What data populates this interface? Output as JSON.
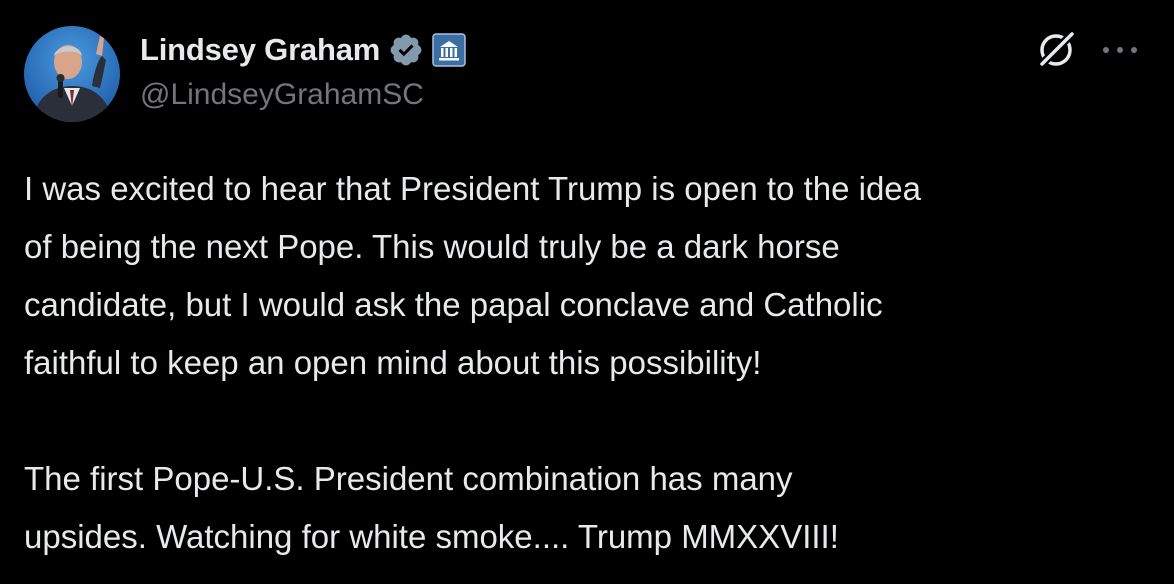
{
  "author": {
    "display_name": "Lindsey Graham",
    "handle": "@LindseyGrahamSC",
    "avatar_icon": "profile-photo",
    "verified_icon": "verified-badge-icon",
    "affiliation_icon": "government-building-icon"
  },
  "actions": {
    "grok_icon": "grok-icon",
    "more_icon": "more-options-icon"
  },
  "tweet": {
    "paragraphs": [
      {
        "lines": [
          "I was excited to hear that President Trump is open to the idea",
          "of being the next Pope. This would truly be a dark horse",
          "candidate, but I would ask the papal conclave and Catholic",
          "faithful to keep an open mind about this possibility!"
        ]
      },
      {
        "lines": [
          "The first Pope-U.S. President combination has many",
          "upsides. Watching for white smoke.... Trump MMXXVIII!"
        ]
      }
    ]
  },
  "colors": {
    "background": "#000000",
    "text_primary": "#e7e9ea",
    "text_secondary": "#71767b",
    "badge_gray": "#829aab",
    "gov_badge": "#3b6ea5"
  }
}
